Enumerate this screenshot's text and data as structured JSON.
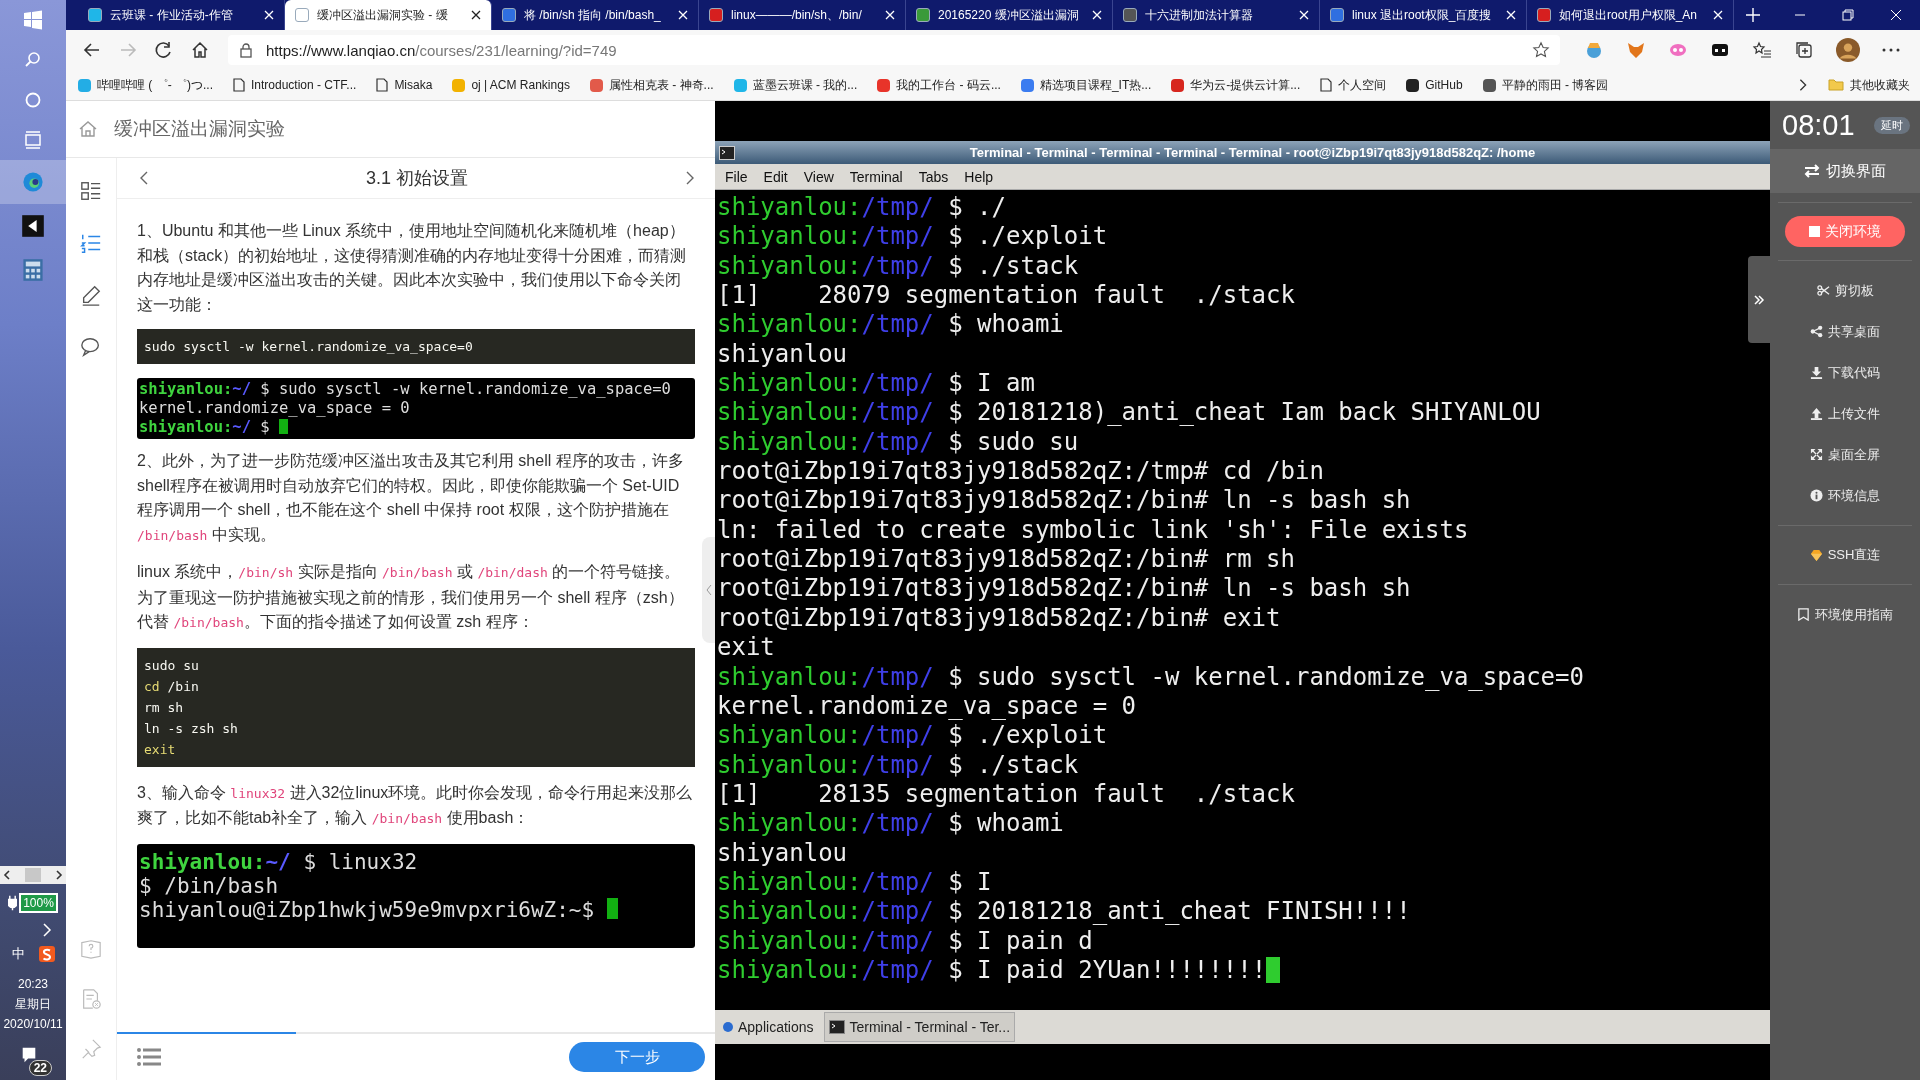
{
  "taskbar": {
    "apps": [
      {
        "selected": true
      },
      {
        "selected": false
      },
      {
        "selected": false
      }
    ],
    "battery": "100%",
    "ime": "中",
    "clock": {
      "time": "20:23",
      "weekday": "星期日",
      "date": "2020/10/11"
    },
    "notifications": "22"
  },
  "browser": {
    "tabs": [
      {
        "title": "云班课 - 作业活动-作管",
        "selected": false
      },
      {
        "title": "缓冲区溢出漏洞实验 - 缓",
        "selected": true
      },
      {
        "title": "将 /bin/sh 指向 /bin/bash_",
        "selected": false
      },
      {
        "title": "linux———/bin/sh、/bin/",
        "selected": false
      },
      {
        "title": "20165220 缓冲区溢出漏洞",
        "selected": false
      },
      {
        "title": "十六进制加法计算器",
        "selected": false
      },
      {
        "title": "linux 退出root权限_百度搜",
        "selected": false
      },
      {
        "title": "如何退出root用户权限_An",
        "selected": false
      }
    ],
    "url_host": "https://www.lanqiao.cn",
    "url_path": "/courses/231/learning/?id=749",
    "bookmarks": [
      "哔哩哔哩 ( ゜- ゜)つ...",
      "Introduction - CTF...",
      "Misaka",
      "oj | ACM Rankings",
      "属性相克表 - 神奇...",
      "蓝墨云班课 - 我的...",
      "我的工作台 - 码云...",
      "精选项目课程_IT热...",
      "华为云-提供云计算...",
      "个人空间",
      "GitHub",
      "平静的雨田 - 博客园"
    ],
    "other_bookmarks": "其他收藏夹"
  },
  "course": {
    "title": "缓冲区溢出漏洞实验",
    "chapter": "3.1 初始设置",
    "rail": [
      {
        "selected": false
      },
      {
        "selected": true
      },
      {
        "selected": false
      },
      {
        "selected": false
      }
    ],
    "blocks": [
      {
        "kind": "paragraph",
        "parts": [
          {
            "kind": "text",
            "text": "1、Ubuntu 和其他一些 Linux 系统中，使用地址空间随机化来随机堆（heap）和栈（stack）的初始地址，这使得猜测准确的内存地址变得十分困难，而猜测内存地址是缓冲区溢出攻击的关键。因此本次实验中，我们使用以下命令关闭这一功能："
          }
        ]
      },
      {
        "kind": "code",
        "lines": [
          [
            {
              "kind": "plain",
              "text": "sudo sysctl -w kernel.randomize_va_space=0"
            }
          ]
        ]
      },
      {
        "kind": "shot",
        "cursor": true,
        "lines": [
          {
            "kind": "prompt",
            "user": "shiyanlou:",
            "path": "~/",
            "command": " $ sudo sysctl -w kernel.randomize_va_space=0"
          },
          {
            "kind": "output",
            "text": "kernel.randomize_va_space = 0"
          },
          {
            "kind": "prompt",
            "user": "shiyanlou:",
            "path": "~/",
            "command": " $ "
          }
        ]
      },
      {
        "kind": "paragraph",
        "parts": [
          {
            "kind": "text",
            "text": "2、此外，为了进一步防范缓冲区溢出攻击及其它利用 shell 程序的攻击，许多shell程序在被调用时自动放弃它们的特权。因此，即使你能欺骗一个 Set-UID 程序调用一个 shell，也不能在这个 shell 中保持 root 权限，这个防护措施在 "
          },
          {
            "kind": "code",
            "text": "/bin/bash"
          },
          {
            "kind": "text",
            "text": " 中实现。"
          }
        ]
      },
      {
        "kind": "paragraph",
        "parts": [
          {
            "kind": "text",
            "text": "linux 系统中，"
          },
          {
            "kind": "code",
            "text": "/bin/sh"
          },
          {
            "kind": "text",
            "text": " 实际是指向 "
          },
          {
            "kind": "code",
            "text": "/bin/bash"
          },
          {
            "kind": "text",
            "text": " 或 "
          },
          {
            "kind": "code",
            "text": "/bin/dash"
          },
          {
            "kind": "text",
            "text": " 的一个符号链接。为了重现这一防护措施被实现之前的情形，我们使用另一个 shell 程序（zsh）代替 "
          },
          {
            "kind": "code",
            "text": "/bin/bash"
          },
          {
            "kind": "text",
            "text": "。下面的指令描述了如何设置 zsh 程序："
          }
        ]
      },
      {
        "kind": "code",
        "lines": [
          [
            {
              "kind": "plain",
              "text": "sudo su"
            }
          ],
          [
            {
              "kind": "keyword",
              "text": "cd"
            },
            {
              "kind": "plain",
              "text": " /bin"
            }
          ],
          [
            {
              "kind": "plain",
              "text": "rm sh"
            }
          ],
          [
            {
              "kind": "plain",
              "text": "ln -s zsh sh"
            }
          ],
          [
            {
              "kind": "keyword",
              "text": "exit"
            }
          ]
        ]
      },
      {
        "kind": "paragraph",
        "parts": [
          {
            "kind": "text",
            "text": "3、输入命令 "
          },
          {
            "kind": "code",
            "text": "linux32"
          },
          {
            "kind": "text",
            "text": " 进入32位linux环境。此时你会发现，命令行用起来没那么爽了，比如不能tab补全了，输入 "
          },
          {
            "kind": "code",
            "text": "/bin/bash"
          },
          {
            "kind": "text",
            "text": " 使用bash："
          }
        ]
      },
      {
        "kind": "shot",
        "cursor": true,
        "lines": [
          {
            "kind": "prompt",
            "user": "shiyanlou:",
            "path": "~/",
            "command": " $ linux32"
          },
          {
            "kind": "output",
            "text": "$ /bin/bash"
          },
          {
            "kind": "output",
            "text": "shiyanlou@iZbp1hwkjw59e9mvpxri6wZ:~$ "
          }
        ]
      }
    ],
    "progress": {
      "level": 0.3
    },
    "next_button": "下一步"
  },
  "terminal": {
    "title": "Terminal - Terminal - Terminal - Terminal - Terminal - root@iZbp19i7qt83jy918d582qZ: /home",
    "menu": [
      "File",
      "Edit",
      "View",
      "Terminal",
      "Tabs",
      "Help"
    ],
    "cursor": true,
    "lines": [
      {
        "kind": "prompt",
        "user": "shiyanlou:",
        "path": "/tmp/",
        "command": " $ ./"
      },
      {
        "kind": "prompt",
        "user": "shiyanlou:",
        "path": "/tmp/",
        "command": " $ ./exploit"
      },
      {
        "kind": "prompt",
        "user": "shiyanlou:",
        "path": "/tmp/",
        "command": " $ ./stack"
      },
      {
        "kind": "output",
        "text": "[1]    28079 segmentation fault  ./stack"
      },
      {
        "kind": "prompt",
        "user": "shiyanlou:",
        "path": "/tmp/",
        "command": " $ whoami"
      },
      {
        "kind": "output",
        "text": "shiyanlou"
      },
      {
        "kind": "prompt",
        "user": "shiyanlou:",
        "path": "/tmp/",
        "command": " $ I am"
      },
      {
        "kind": "prompt",
        "user": "shiyanlou:",
        "path": "/tmp/",
        "command": " $ 20181218)_anti_cheat Iam back SHIYANLOU"
      },
      {
        "kind": "prompt",
        "user": "shiyanlou:",
        "path": "/tmp/",
        "command": " $ sudo su"
      },
      {
        "kind": "output",
        "text": "root@iZbp19i7qt83jy918d582qZ:/tmp# cd /bin"
      },
      {
        "kind": "output",
        "text": "root@iZbp19i7qt83jy918d582qZ:/bin# ln -s bash sh"
      },
      {
        "kind": "output",
        "text": "ln: failed to create symbolic link 'sh': File exists"
      },
      {
        "kind": "output",
        "text": "root@iZbp19i7qt83jy918d582qZ:/bin# rm sh"
      },
      {
        "kind": "output",
        "text": "root@iZbp19i7qt83jy918d582qZ:/bin# ln -s bash sh"
      },
      {
        "kind": "output",
        "text": "root@iZbp19i7qt83jy918d582qZ:/bin# exit"
      },
      {
        "kind": "output",
        "text": "exit"
      },
      {
        "kind": "prompt",
        "user": "shiyanlou:",
        "path": "/tmp/",
        "command": " $ sudo sysctl -w kernel.randomize_va_space=0"
      },
      {
        "kind": "output",
        "text": "kernel.randomize_va_space = 0"
      },
      {
        "kind": "prompt",
        "user": "shiyanlou:",
        "path": "/tmp/",
        "command": " $ ./exploit"
      },
      {
        "kind": "prompt",
        "user": "shiyanlou:",
        "path": "/tmp/",
        "command": " $ ./stack"
      },
      {
        "kind": "output",
        "text": "[1]    28135 segmentation fault  ./stack"
      },
      {
        "kind": "prompt",
        "user": "shiyanlou:",
        "path": "/tmp/",
        "command": " $ whoami"
      },
      {
        "kind": "output",
        "text": "shiyanlou"
      },
      {
        "kind": "prompt",
        "user": "shiyanlou:",
        "path": "/tmp/",
        "command": " $ I"
      },
      {
        "kind": "prompt",
        "user": "shiyanlou:",
        "path": "/tmp/",
        "command": " $ 20181218_anti_cheat FINISH!!!!"
      },
      {
        "kind": "prompt",
        "user": "shiyanlou:",
        "path": "/tmp/",
        "command": " $ I pain d"
      },
      {
        "kind": "prompt",
        "user": "shiyanlou:",
        "path": "/tmp/",
        "command": " $ I paid 2YUan!!!!!!!!"
      }
    ],
    "panel": {
      "applications": "Applications",
      "task": "Terminal - Terminal - Ter..."
    }
  },
  "sidebar": {
    "timer": "08:01",
    "extend": "延时",
    "switch": "切换界面",
    "close_env": "关闭环境",
    "tools": [
      "剪切板",
      "共享桌面",
      "下载代码",
      "上传文件",
      "桌面全屏",
      "环境信息"
    ],
    "ssh": "SSH直连",
    "guide": "环境使用指南"
  }
}
